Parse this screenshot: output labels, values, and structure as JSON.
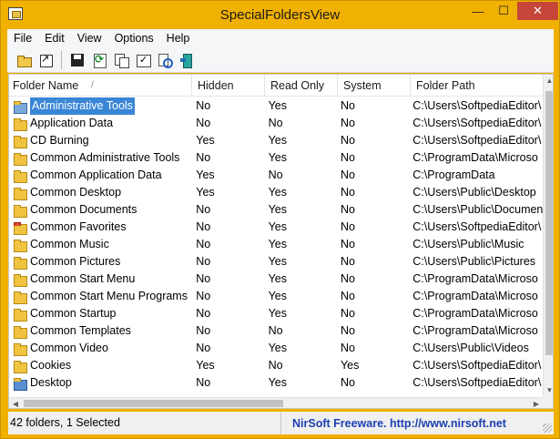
{
  "window": {
    "title": "SpecialFoldersView"
  },
  "window_controls": {
    "minimize": "—",
    "maximize": "☐",
    "close": "✕"
  },
  "menu": [
    "File",
    "Edit",
    "View",
    "Options",
    "Help"
  ],
  "toolbar_icons": [
    "folder-icon",
    "open-icon",
    "save-icon",
    "refresh-icon",
    "copy-icon",
    "properties-icon",
    "search-icon",
    "exit-icon"
  ],
  "columns": [
    "Folder Name",
    "Hidden",
    "Read Only",
    "System",
    "Folder Path"
  ],
  "sort_indicator": "/",
  "rows": [
    {
      "name": "Administrative Tools",
      "hidden": "No",
      "readonly": "Yes",
      "system": "No",
      "path": "C:\\Users\\SoftpediaEditor\\",
      "icon": "tools",
      "selected": true
    },
    {
      "name": "Application Data",
      "hidden": "No",
      "readonly": "No",
      "system": "No",
      "path": "C:\\Users\\SoftpediaEditor\\"
    },
    {
      "name": "CD Burning",
      "hidden": "Yes",
      "readonly": "Yes",
      "system": "No",
      "path": "C:\\Users\\SoftpediaEditor\\"
    },
    {
      "name": "Common Administrative Tools",
      "hidden": "No",
      "readonly": "Yes",
      "system": "No",
      "path": "C:\\ProgramData\\Microso"
    },
    {
      "name": "Common Application Data",
      "hidden": "Yes",
      "readonly": "No",
      "system": "No",
      "path": "C:\\ProgramData"
    },
    {
      "name": "Common Desktop",
      "hidden": "Yes",
      "readonly": "Yes",
      "system": "No",
      "path": "C:\\Users\\Public\\Desktop"
    },
    {
      "name": "Common Documents",
      "hidden": "No",
      "readonly": "Yes",
      "system": "No",
      "path": "C:\\Users\\Public\\Documents"
    },
    {
      "name": "Common Favorites",
      "hidden": "No",
      "readonly": "Yes",
      "system": "No",
      "path": "C:\\Users\\SoftpediaEditor\\",
      "icon": "fav"
    },
    {
      "name": "Common Music",
      "hidden": "No",
      "readonly": "Yes",
      "system": "No",
      "path": "C:\\Users\\Public\\Music"
    },
    {
      "name": "Common Pictures",
      "hidden": "No",
      "readonly": "Yes",
      "system": "No",
      "path": "C:\\Users\\Public\\Pictures"
    },
    {
      "name": "Common Start Menu",
      "hidden": "No",
      "readonly": "Yes",
      "system": "No",
      "path": "C:\\ProgramData\\Microso"
    },
    {
      "name": "Common Start Menu Programs",
      "hidden": "No",
      "readonly": "Yes",
      "system": "No",
      "path": "C:\\ProgramData\\Microso"
    },
    {
      "name": "Common Startup",
      "hidden": "No",
      "readonly": "Yes",
      "system": "No",
      "path": "C:\\ProgramData\\Microso"
    },
    {
      "name": "Common Templates",
      "hidden": "No",
      "readonly": "No",
      "system": "No",
      "path": "C:\\ProgramData\\Microso"
    },
    {
      "name": "Common Video",
      "hidden": "No",
      "readonly": "Yes",
      "system": "No",
      "path": "C:\\Users\\Public\\Videos"
    },
    {
      "name": "Cookies",
      "hidden": "Yes",
      "readonly": "No",
      "system": "Yes",
      "path": "C:\\Users\\SoftpediaEditor\\"
    },
    {
      "name": "Desktop",
      "hidden": "No",
      "readonly": "Yes",
      "system": "No",
      "path": "C:\\Users\\SoftpediaEditor\\",
      "icon": "desktop"
    }
  ],
  "status": {
    "count": "42 folders, 1 Selected",
    "link": "NirSoft Freeware.  http://www.nirsoft.net"
  }
}
